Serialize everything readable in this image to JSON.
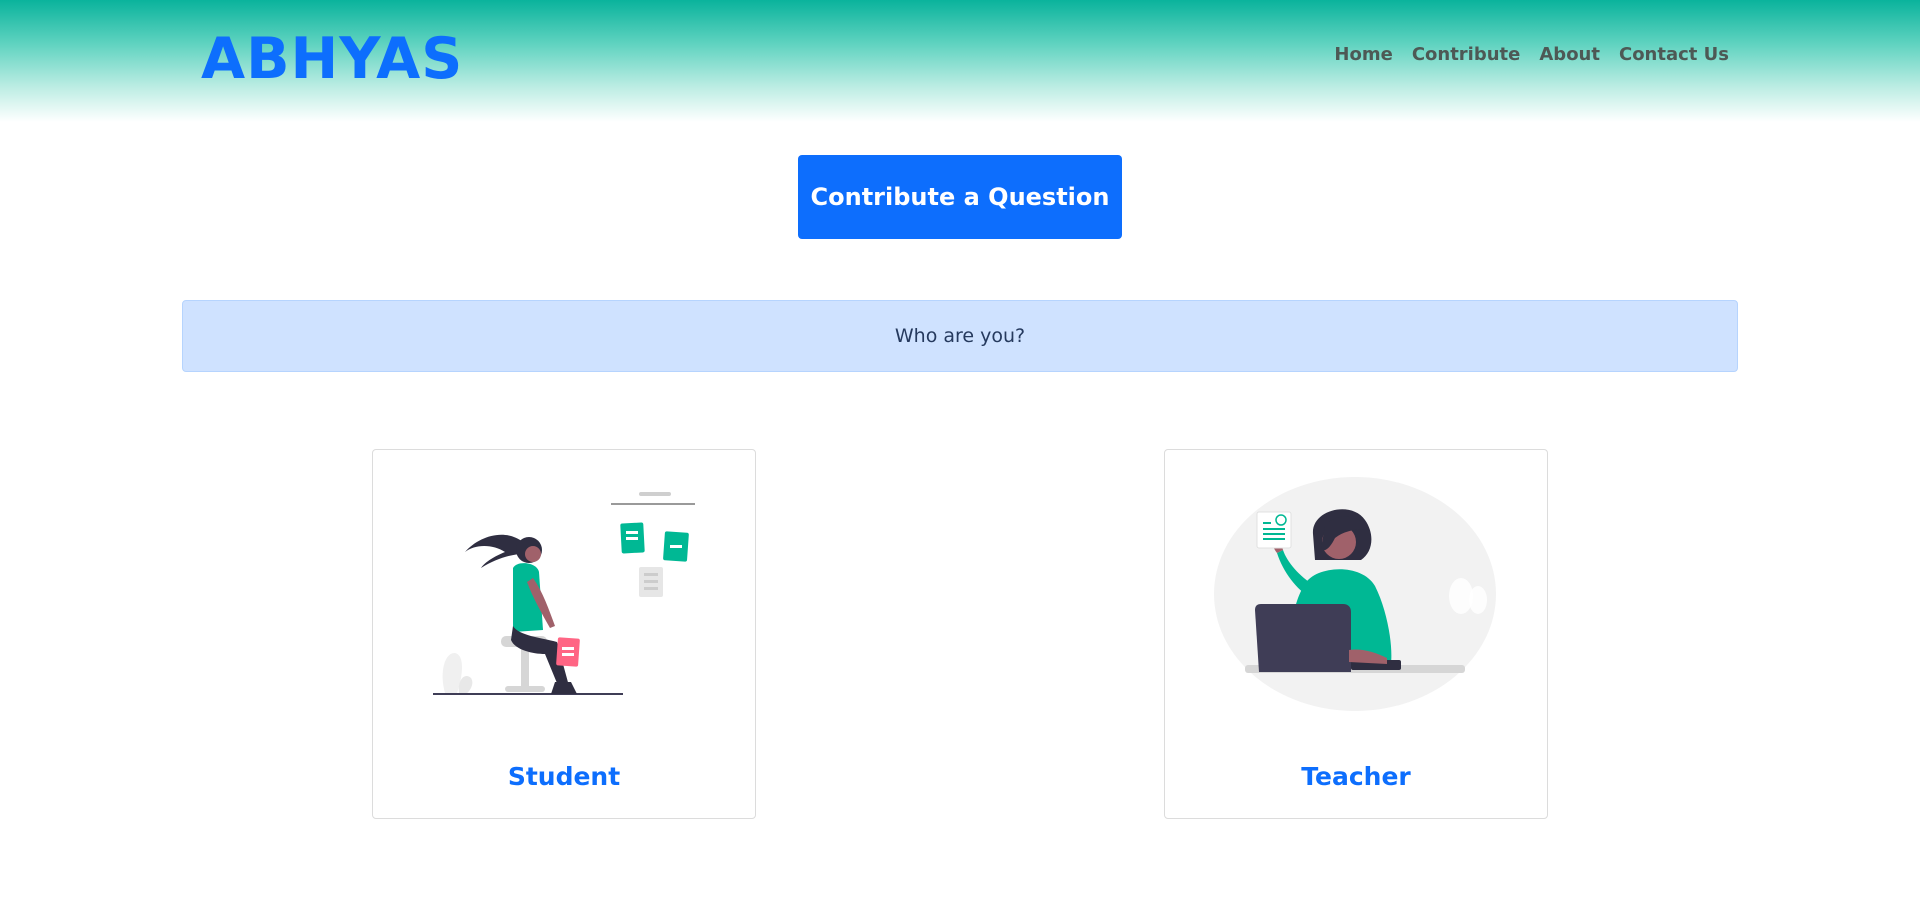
{
  "header": {
    "brand": "ABHYAS",
    "nav": [
      {
        "label": "Home"
      },
      {
        "label": "Contribute"
      },
      {
        "label": "About"
      },
      {
        "label": "Contact Us"
      }
    ]
  },
  "cta": {
    "label": "Contribute a Question"
  },
  "prompt": {
    "text": "Who are you?"
  },
  "roles": [
    {
      "label": "Student",
      "illustration": "student-sitting-illustration"
    },
    {
      "label": "Teacher",
      "illustration": "teacher-laptop-illustration"
    }
  ],
  "colors": {
    "header_gradient_top": "#0ab39c",
    "brand": "#0d6efd",
    "button": "#0d6efd",
    "alert_bg": "#cfe2ff",
    "accent_teal": "#00b894",
    "accent_pink": "#ff6584"
  }
}
